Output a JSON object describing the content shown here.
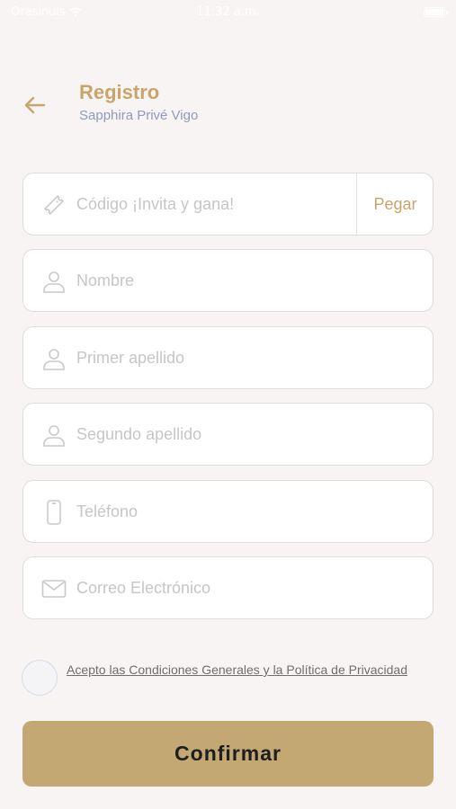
{
  "status_bar": {
    "carrier": "Orasinuls",
    "time": "11:32 a.m."
  },
  "header": {
    "title": "Registro",
    "subtitle": "Sapphira Privé Vigo",
    "back_icon": "arrow-left-icon"
  },
  "form": {
    "code": {
      "placeholder": "Código ¡Invita y gana!",
      "icon": "ticket-icon",
      "paste_label": "Pegar"
    },
    "first_name": {
      "placeholder": "Nombre",
      "icon": "user-icon"
    },
    "last_name_1": {
      "placeholder": "Primer apellido",
      "icon": "user-icon"
    },
    "last_name_2": {
      "placeholder": "Segundo apellido",
      "icon": "user-icon"
    },
    "phone": {
      "placeholder": "Teléfono",
      "icon": "phone-icon"
    },
    "email": {
      "placeholder": "Correo Electrónico",
      "icon": "mail-icon"
    }
  },
  "terms": {
    "label": "Acepto las Condiciones Generales y la Política de Privacidad",
    "checked": false
  },
  "confirm_label": "Confirmar",
  "colors": {
    "accent": "#c7a56b",
    "button": "#c4a873",
    "subtitle": "#8e9bbd",
    "background": "#f7f4f3"
  }
}
